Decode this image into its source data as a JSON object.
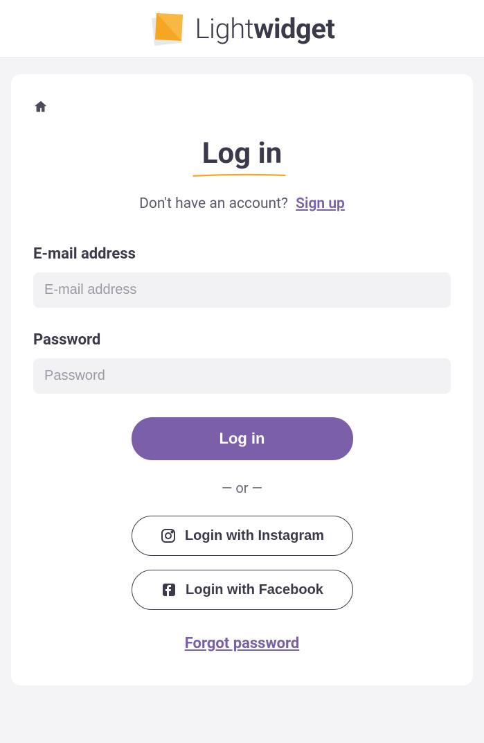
{
  "brand": {
    "light": "Light",
    "widget": "widget"
  },
  "title": "Log in",
  "signup": {
    "prompt": "Don't have an account?",
    "link": "Sign up"
  },
  "fields": {
    "email": {
      "label": "E-mail address",
      "placeholder": "E-mail address"
    },
    "password": {
      "label": "Password",
      "placeholder": "Password"
    }
  },
  "buttons": {
    "login": "Log in",
    "instagram": "Login with Instagram",
    "facebook": "Login with Facebook"
  },
  "divider": "— or —",
  "forgot": "Forgot password"
}
